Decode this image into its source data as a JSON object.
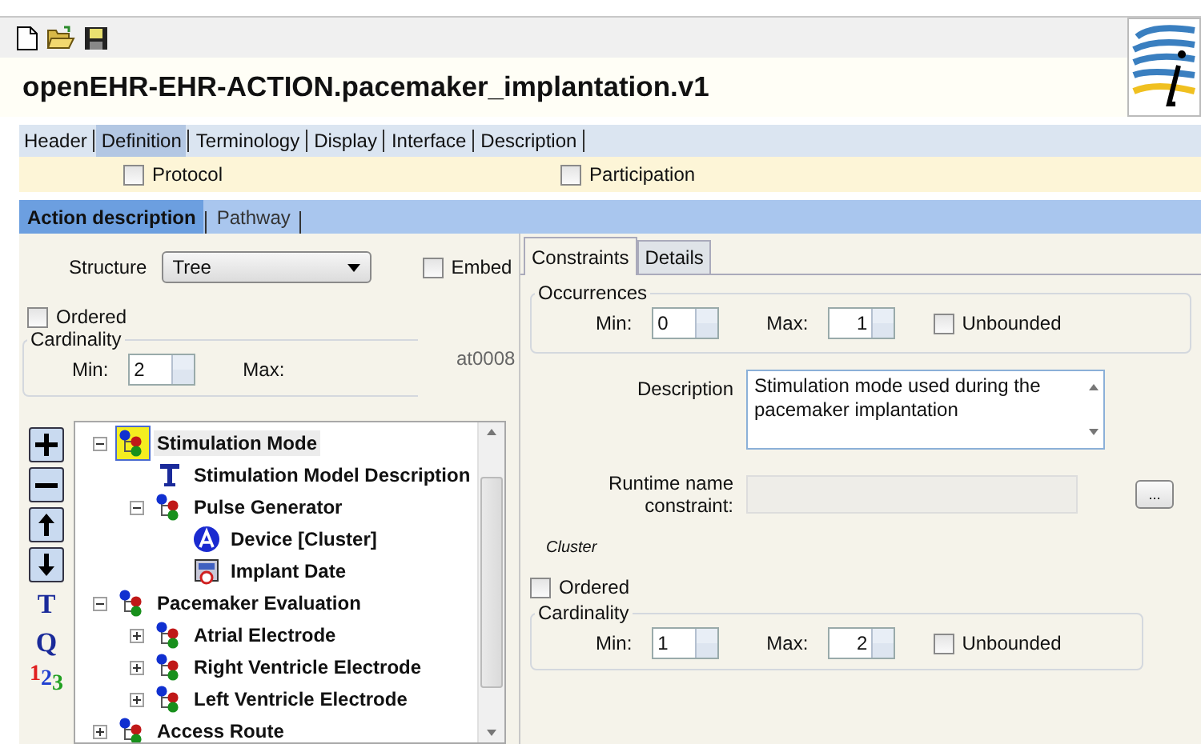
{
  "title": "openEHR-EHR-ACTION.pacemaker_implantation.v1",
  "tabs": [
    {
      "label": "Header",
      "selected": false
    },
    {
      "label": "Definition",
      "selected": true
    },
    {
      "label": "Terminology",
      "selected": false
    },
    {
      "label": "Display",
      "selected": false
    },
    {
      "label": "Interface",
      "selected": false
    },
    {
      "label": "Description",
      "selected": false
    }
  ],
  "sections": [
    {
      "label": "Protocol",
      "checked": false
    },
    {
      "label": "Participation",
      "checked": false
    }
  ],
  "subtabs": [
    {
      "label": "Action description",
      "selected": true
    },
    {
      "label": "Pathway",
      "selected": false
    }
  ],
  "structure": {
    "label": "Structure",
    "value": "Tree",
    "embedded": {
      "label": "Embed",
      "checked": false
    },
    "ordered": {
      "label": "Ordered",
      "checked": false
    },
    "cardinality": {
      "title": "Cardinality",
      "min_label": "Min:",
      "min": "2",
      "max_label": "Max:"
    },
    "code": "at0008"
  },
  "tool_glyphs": [
    "T",
    "Q",
    "123"
  ],
  "tree": [
    {
      "label": "Stimulation Mode",
      "kind": "cluster",
      "expanded": true,
      "selected": true,
      "children": [
        {
          "label": "Stimulation Model Description",
          "kind": "text",
          "selected": false
        },
        {
          "label": "Pulse Generator",
          "kind": "cluster",
          "expanded": true,
          "selected": false,
          "children": [
            {
              "label": "Device [Cluster]",
              "kind": "choice",
              "selected": false
            },
            {
              "label": "Implant Date",
              "kind": "datetime",
              "selected": false
            }
          ]
        }
      ]
    },
    {
      "label": "Pacemaker Evaluation",
      "kind": "cluster",
      "expanded": true,
      "selected": false,
      "children": [
        {
          "label": "Atrial Electrode",
          "kind": "cluster",
          "expanded": false,
          "selected": false
        },
        {
          "label": "Right Ventricle Electrode",
          "kind": "cluster",
          "expanded": false,
          "selected": false
        },
        {
          "label": "Left Ventricle Electrode",
          "kind": "cluster",
          "expanded": false,
          "selected": false
        }
      ]
    },
    {
      "label": "Access Route",
      "kind": "cluster",
      "expanded": false,
      "selected": false
    }
  ],
  "detail_tabs": [
    {
      "label": "Constraints",
      "selected": true
    },
    {
      "label": "Details",
      "selected": false
    }
  ],
  "occurrences": {
    "title": "Occurrences",
    "min_label": "Min:",
    "min": "0",
    "max_label": "Max:",
    "max": "1",
    "unbounded": {
      "label": "Unbounded",
      "checked": false
    }
  },
  "description": {
    "label": "Description",
    "value": "Stimulation mode used during the pacemaker implantation"
  },
  "runtime_name": {
    "label": "Runtime name constraint:",
    "button": "..."
  },
  "cluster_label": "Cluster",
  "ordered": {
    "label": "Ordered",
    "checked": false
  },
  "cardinality": {
    "title": "Cardinality",
    "min_label": "Min:",
    "min": "1",
    "max_label": "Max:",
    "max": "2",
    "unbounded": {
      "label": "Unbounded",
      "checked": false
    }
  }
}
